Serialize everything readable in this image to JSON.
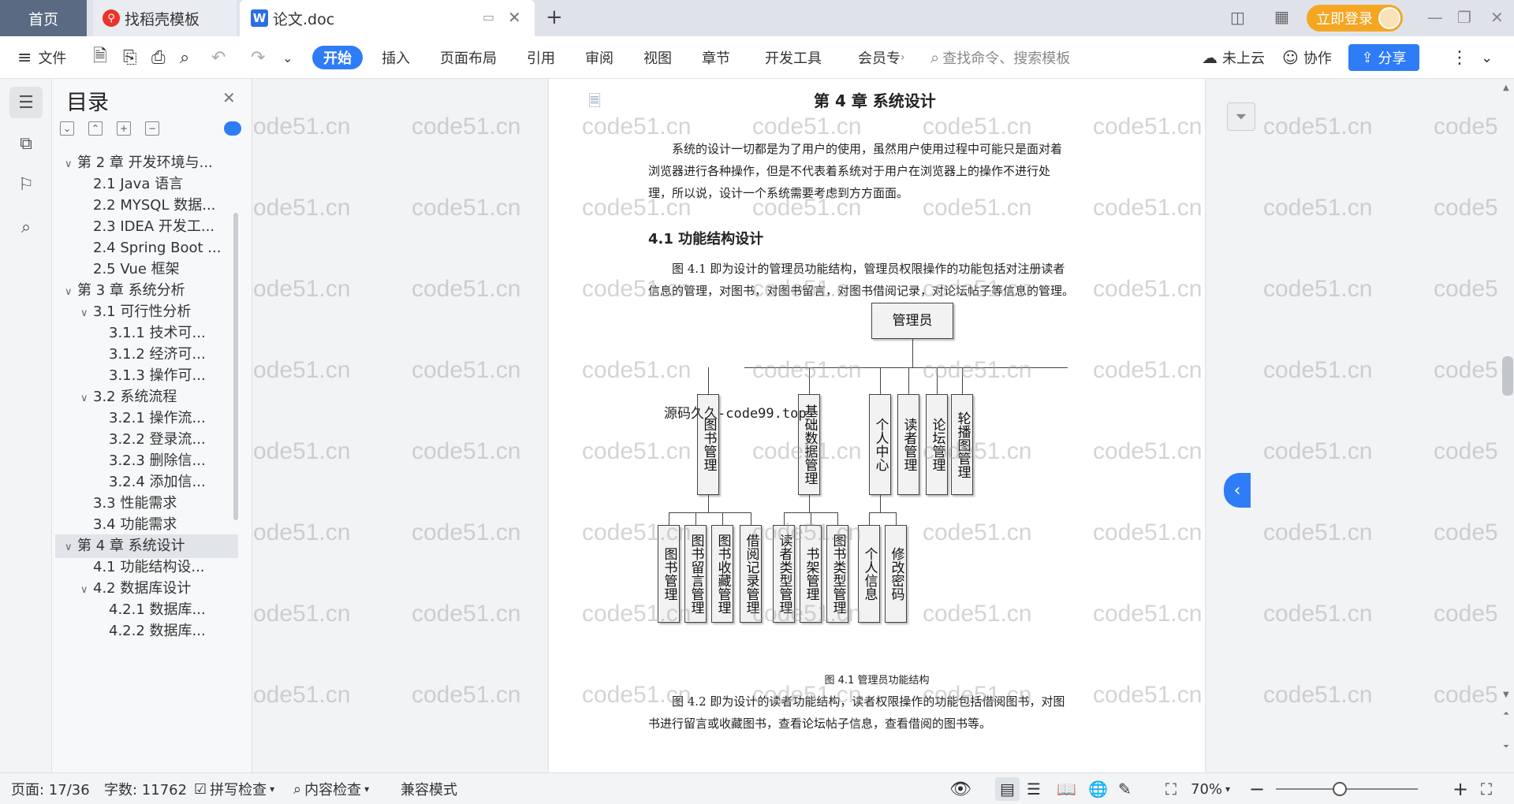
{
  "tabs": {
    "home": "首页",
    "daoke": "找稻壳模板",
    "doc": "论文.doc",
    "doc_icon": "W"
  },
  "login": "立即登录",
  "toolbar": {
    "file": "文件",
    "start": "开始",
    "insert": "插入",
    "layout": "页面布局",
    "reference": "引用",
    "review": "审阅",
    "view": "视图",
    "chapter": "章节",
    "devtools": "开发工具",
    "member": "会员专",
    "search_placeholder": "查找命令、搜索模板",
    "cloud": "未上云",
    "collab": "协作",
    "share": "分享"
  },
  "toc": {
    "title": "目录",
    "items": [
      {
        "label": "第 2 章  开发环境与...",
        "level": 0,
        "arrow": "∨"
      },
      {
        "label": "2.1 Java 语言",
        "level": 1,
        "arrow": ""
      },
      {
        "label": "2.2 MYSQL 数据...",
        "level": 1,
        "arrow": ""
      },
      {
        "label": "2.3 IDEA 开发工...",
        "level": 1,
        "arrow": ""
      },
      {
        "label": "2.4 Spring Boot ...",
        "level": 1,
        "arrow": ""
      },
      {
        "label": "2.5 Vue 框架",
        "level": 1,
        "arrow": ""
      },
      {
        "label": "第 3 章  系统分析",
        "level": 0,
        "arrow": "∨"
      },
      {
        "label": "3.1  可行性分析",
        "level": 1,
        "arrow": "∨"
      },
      {
        "label": "3.1.1  技术可...",
        "level": 2,
        "arrow": ""
      },
      {
        "label": "3.1.2  经济可...",
        "level": 2,
        "arrow": ""
      },
      {
        "label": "3.1.3  操作可...",
        "level": 2,
        "arrow": ""
      },
      {
        "label": "3.2  系统流程",
        "level": 1,
        "arrow": "∨"
      },
      {
        "label": "3.2.1  操作流...",
        "level": 2,
        "arrow": ""
      },
      {
        "label": "3.2.2  登录流...",
        "level": 2,
        "arrow": ""
      },
      {
        "label": "3.2.3  删除信...",
        "level": 2,
        "arrow": ""
      },
      {
        "label": "3.2.4  添加信...",
        "level": 2,
        "arrow": ""
      },
      {
        "label": "3.3  性能需求",
        "level": 1,
        "arrow": ""
      },
      {
        "label": "3.4  功能需求",
        "level": 1,
        "arrow": ""
      },
      {
        "label": "第 4 章  系统设计",
        "level": 0,
        "arrow": "∨",
        "selected": true
      },
      {
        "label": "4.1  功能结构设...",
        "level": 1,
        "arrow": ""
      },
      {
        "label": "4.2  数据库设计",
        "level": 1,
        "arrow": "∨"
      },
      {
        "label": "4.2.1  数据库...",
        "level": 2,
        "arrow": ""
      },
      {
        "label": "4.2.2  数据库...",
        "level": 2,
        "arrow": ""
      }
    ]
  },
  "doc": {
    "chapter_title": "第 4 章  系统设计",
    "para1_l1": "系统的设计一切都是为了用户的使用，虽然用户使用过程中可能只是面对着",
    "para1_l2": "浏览器进行各种操作，但是不代表着系统对于用户在浏览器上的操作不进行处",
    "para1_l3": "理，所以说，设计一个系统需要考虑到方方面面。",
    "section_title": "4.1  功能结构设计",
    "para2_l1": "图 4.1 即为设计的管理员功能结构，管理员权限操作的功能包括对注册读者",
    "para2_l2": "信息的管理，对图书，对图书留言，对图书借阅记录，对论坛帖子等信息的管理。",
    "caption": "图 4.1  管理员功能结构",
    "para3_l1": "图 4.2 即为设计的读者功能结构，读者权限操作的功能包括借阅图书，对图",
    "para3_l2": "书进行留言或收藏图书，查看论坛帖子信息，查看借阅的图书等。",
    "overlay_text": "源码久久-code99.top"
  },
  "diagram": {
    "root": "管理员",
    "level1": [
      "图书管理",
      "基础数据管理",
      "个人中心",
      "读者管理",
      "论坛管理",
      "轮播图管理"
    ],
    "level2": [
      "图书管理",
      "图书留言管理",
      "图书收藏管理",
      "借阅记录管理",
      "读者类型管理",
      "书架管理",
      "图书类型管理",
      "个人信息",
      "修改密码"
    ]
  },
  "watermark": "code51.cn",
  "status": {
    "page": "页面: 17/36",
    "words": "字数: 11762",
    "spell": "拼写检查",
    "content": "内容检查",
    "compat": "兼容模式",
    "zoom": "70%",
    "zoom_level": 0.5
  }
}
